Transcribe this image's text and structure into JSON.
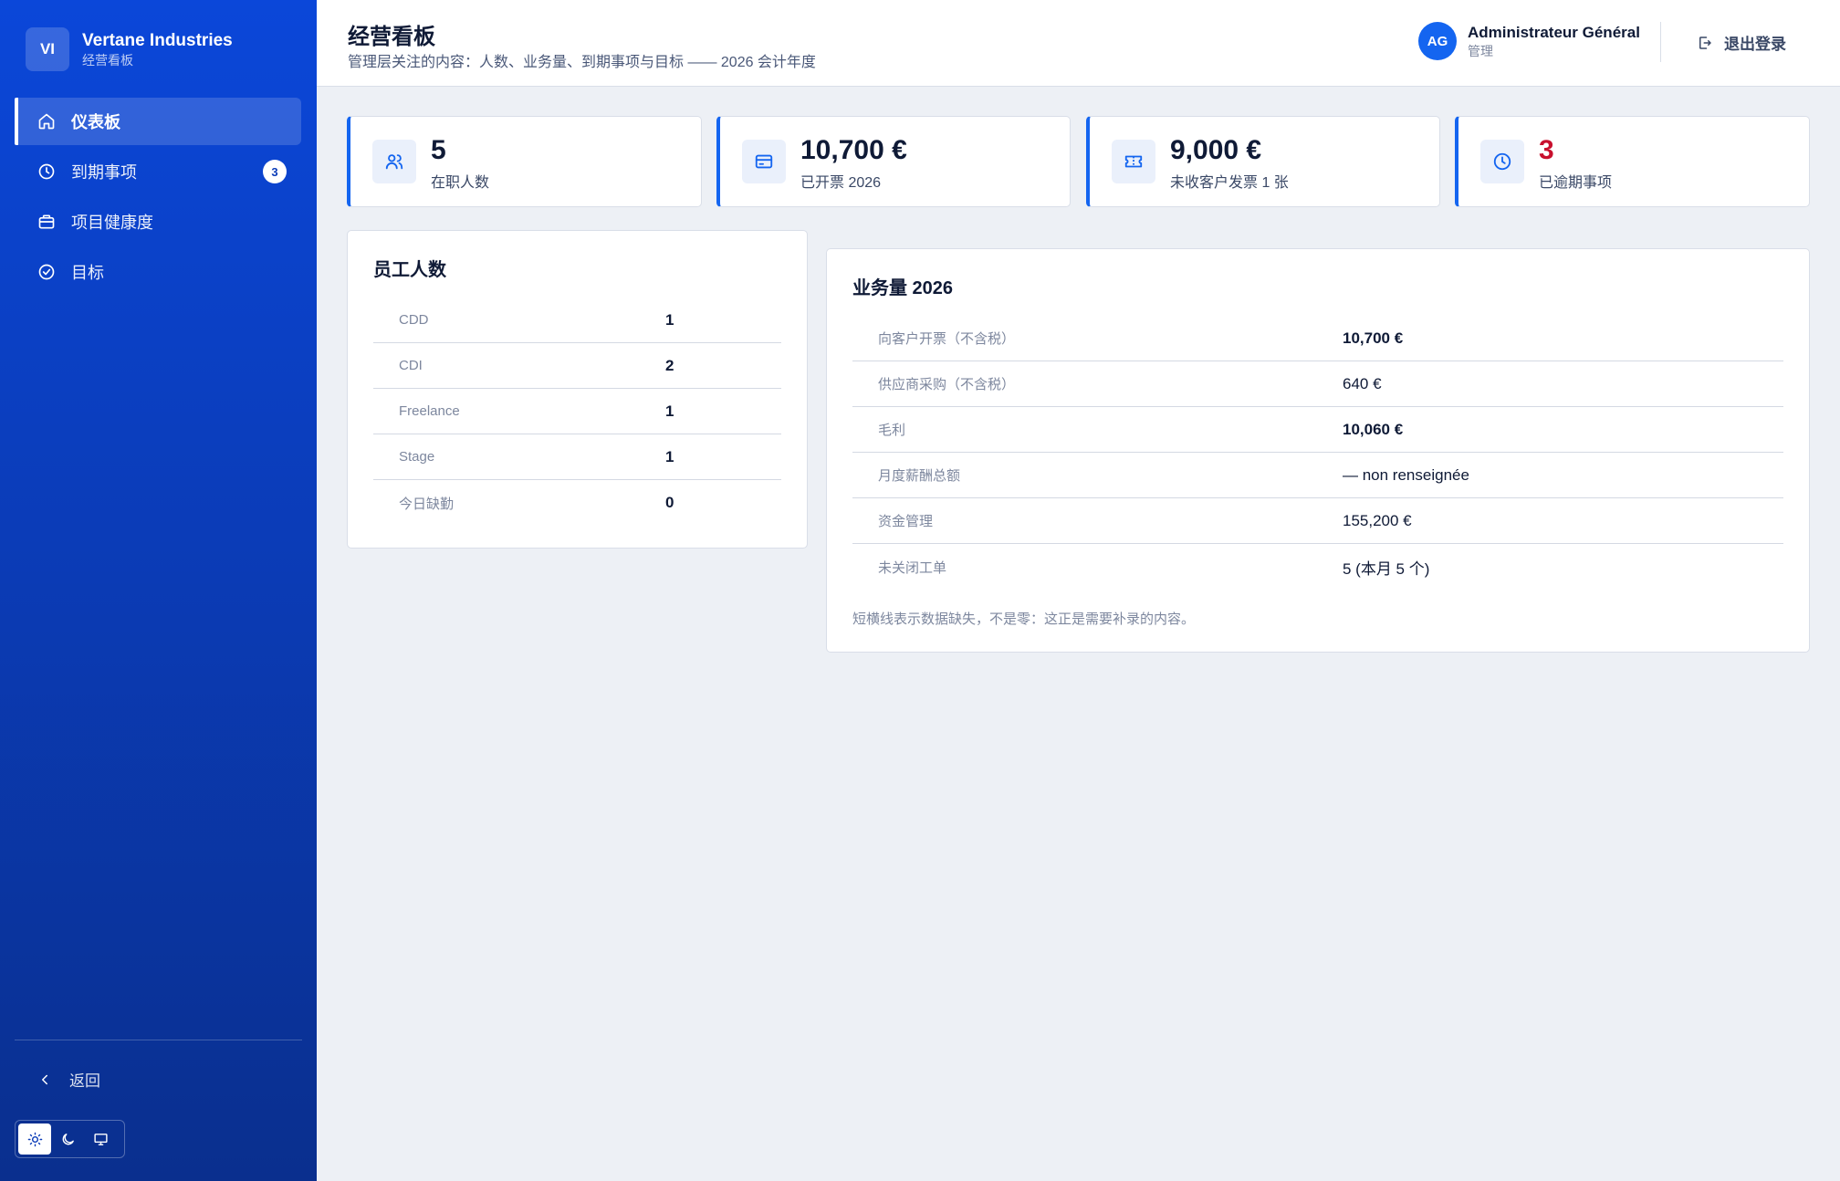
{
  "brand": {
    "logo": "VI",
    "name": "Vertane Industries",
    "subtitle": "经营看板"
  },
  "nav": {
    "items": [
      {
        "label": "仪表板",
        "icon": "home-icon",
        "active": true
      },
      {
        "label": "到期事项",
        "icon": "clock-icon",
        "badge": "3"
      },
      {
        "label": "项目健康度",
        "icon": "briefcase-icon"
      },
      {
        "label": "目标",
        "icon": "check-circle-icon"
      }
    ],
    "back_label": "返回"
  },
  "theme": {
    "options": [
      "sun-icon",
      "moon-icon",
      "monitor-icon"
    ],
    "active": "sun-icon"
  },
  "header": {
    "title": "经营看板",
    "subtitle": "管理层关注的内容：人数、业务量、到期事项与目标 —— 2026 会计年度",
    "user": {
      "initials": "AG",
      "name": "Administrateur Général",
      "role": "管理"
    },
    "logout_label": "退出登录"
  },
  "kpis": [
    {
      "value": "5",
      "label": "在职人数",
      "icon": "users-icon"
    },
    {
      "value": "10,700 €",
      "label": "已开票 2026",
      "icon": "credit-card-icon"
    },
    {
      "value": "9,000 €",
      "label": "未收客户发票 1 张",
      "icon": "ticket-icon"
    },
    {
      "value": "3",
      "label": "已逾期事项",
      "icon": "clock-icon",
      "color": "#c8102e"
    }
  ],
  "headcount": {
    "title": "员工人数",
    "rows": [
      {
        "label": "CDD",
        "value": "1"
      },
      {
        "label": "CDI",
        "value": "2"
      },
      {
        "label": "Freelance",
        "value": "1"
      },
      {
        "label": "Stage",
        "value": "1"
      },
      {
        "label": "今日缺勤",
        "value": "0"
      }
    ]
  },
  "business": {
    "title": "业务量 2026",
    "rows": [
      {
        "label": "向客户开票（不含税）",
        "value": "10,700 €"
      },
      {
        "label": "供应商采购（不含税）",
        "value": "640 €"
      },
      {
        "label": "毛利",
        "value": "10,060 €"
      },
      {
        "label": "月度薪酬总额",
        "value": "— non renseignée"
      },
      {
        "label": "资金管理",
        "value": "155,200 €"
      },
      {
        "label": "未关闭工单",
        "value": "5 (本月 5 个)"
      }
    ],
    "note": "短横线表示数据缺失，不是零：这正是需要补录的内容。"
  },
  "colors": {
    "accent": "#1465f0",
    "sidebar": "#0b47d9",
    "danger": "#c8102e"
  }
}
